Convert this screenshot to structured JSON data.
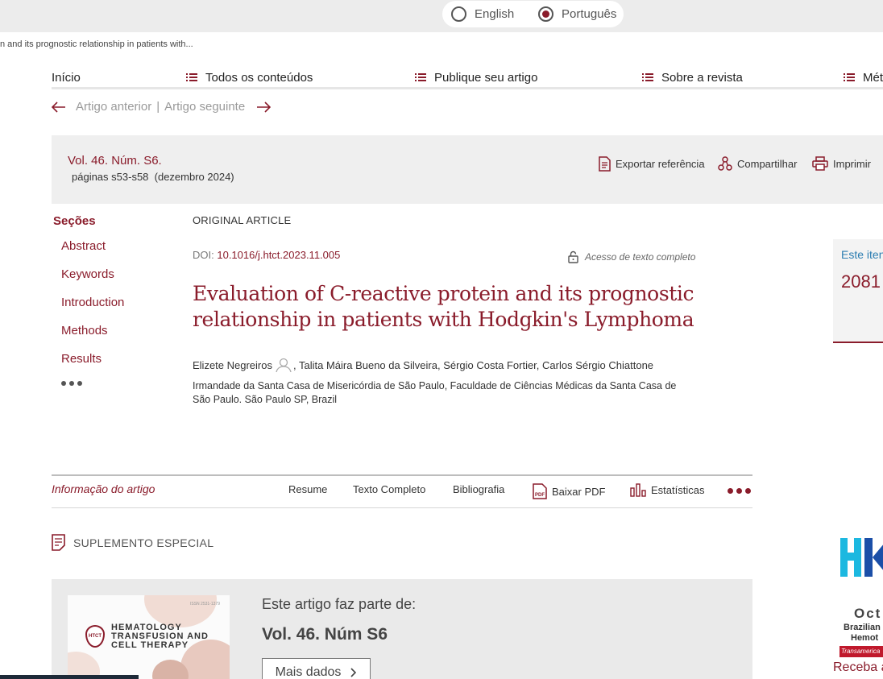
{
  "language": {
    "options": [
      {
        "label": "English",
        "selected": false
      },
      {
        "label": "Português",
        "selected": true
      }
    ]
  },
  "breadcrumb": "n and its prognostic relationship in patients with...",
  "nav": {
    "home": "Início",
    "all_contents": "Todos os conteúdos",
    "publish": "Publique seu artigo",
    "about": "Sobre a revista",
    "metrics": "Mét"
  },
  "article_nav": {
    "prev": "Artigo anterior",
    "sep": "|",
    "next": "Artigo seguinte"
  },
  "issue": {
    "volume": "Vol. 46. Núm. S6.",
    "pages": "páginas s53-s58",
    "date": "(dezembro 2024)"
  },
  "tools": {
    "export": "Exportar referência",
    "share": "Compartilhar",
    "print": "Imprimir"
  },
  "sections": {
    "title": "Seções",
    "items": [
      "Abstract",
      "Keywords",
      "Introduction",
      "Methods",
      "Results"
    ]
  },
  "article": {
    "type": "ORIGINAL ARTICLE",
    "doi_label": "DOI:",
    "doi": "10.1016/j.htct.2023.11.005",
    "access": "Acesso de texto completo",
    "title": "Evaluation of C-reactive protein and its prognostic relationship in patients with Hodgkin's Lymphoma",
    "author_first": "Elizete Negreiros",
    "authors_rest": ", Talita Máira Bueno da Silveira, Sérgio Costa Fortier, Carlos Sérgio Chiattone",
    "affiliation": "Irmandade da Santa Casa de Misericórdia de São Paulo, Faculdade de Ciências Médicas da Santa Casa de São Paulo. São Paulo SP, Brazil"
  },
  "right_card": {
    "label": "Este iten",
    "number": "2081"
  },
  "tabs": {
    "info": "Informação do artigo",
    "summary": "Resume",
    "fulltext": "Texto Completo",
    "bibliography": "Bibliografia",
    "pdf": "Baixar PDF",
    "stats": "Estatísticas"
  },
  "supplement": {
    "heading": "SUPLEMENTO ESPECIAL",
    "part_of": "Este artigo faz parte de:",
    "volume": "Vol. 46. Núm S6",
    "more": "Mais dados",
    "cover_title": "HEMATOLOGY\nTRANSFUSION AND\nCELL THERAPY",
    "cover_logo": "HTCT"
  },
  "ad": {
    "month": "Oct",
    "line1": "Brazilian",
    "line2": "Hemot",
    "banner": "Transamerica",
    "cta": "Receba a"
  },
  "colors": {
    "accent": "#8a1c2b",
    "link_blue": "#2b7db1"
  }
}
